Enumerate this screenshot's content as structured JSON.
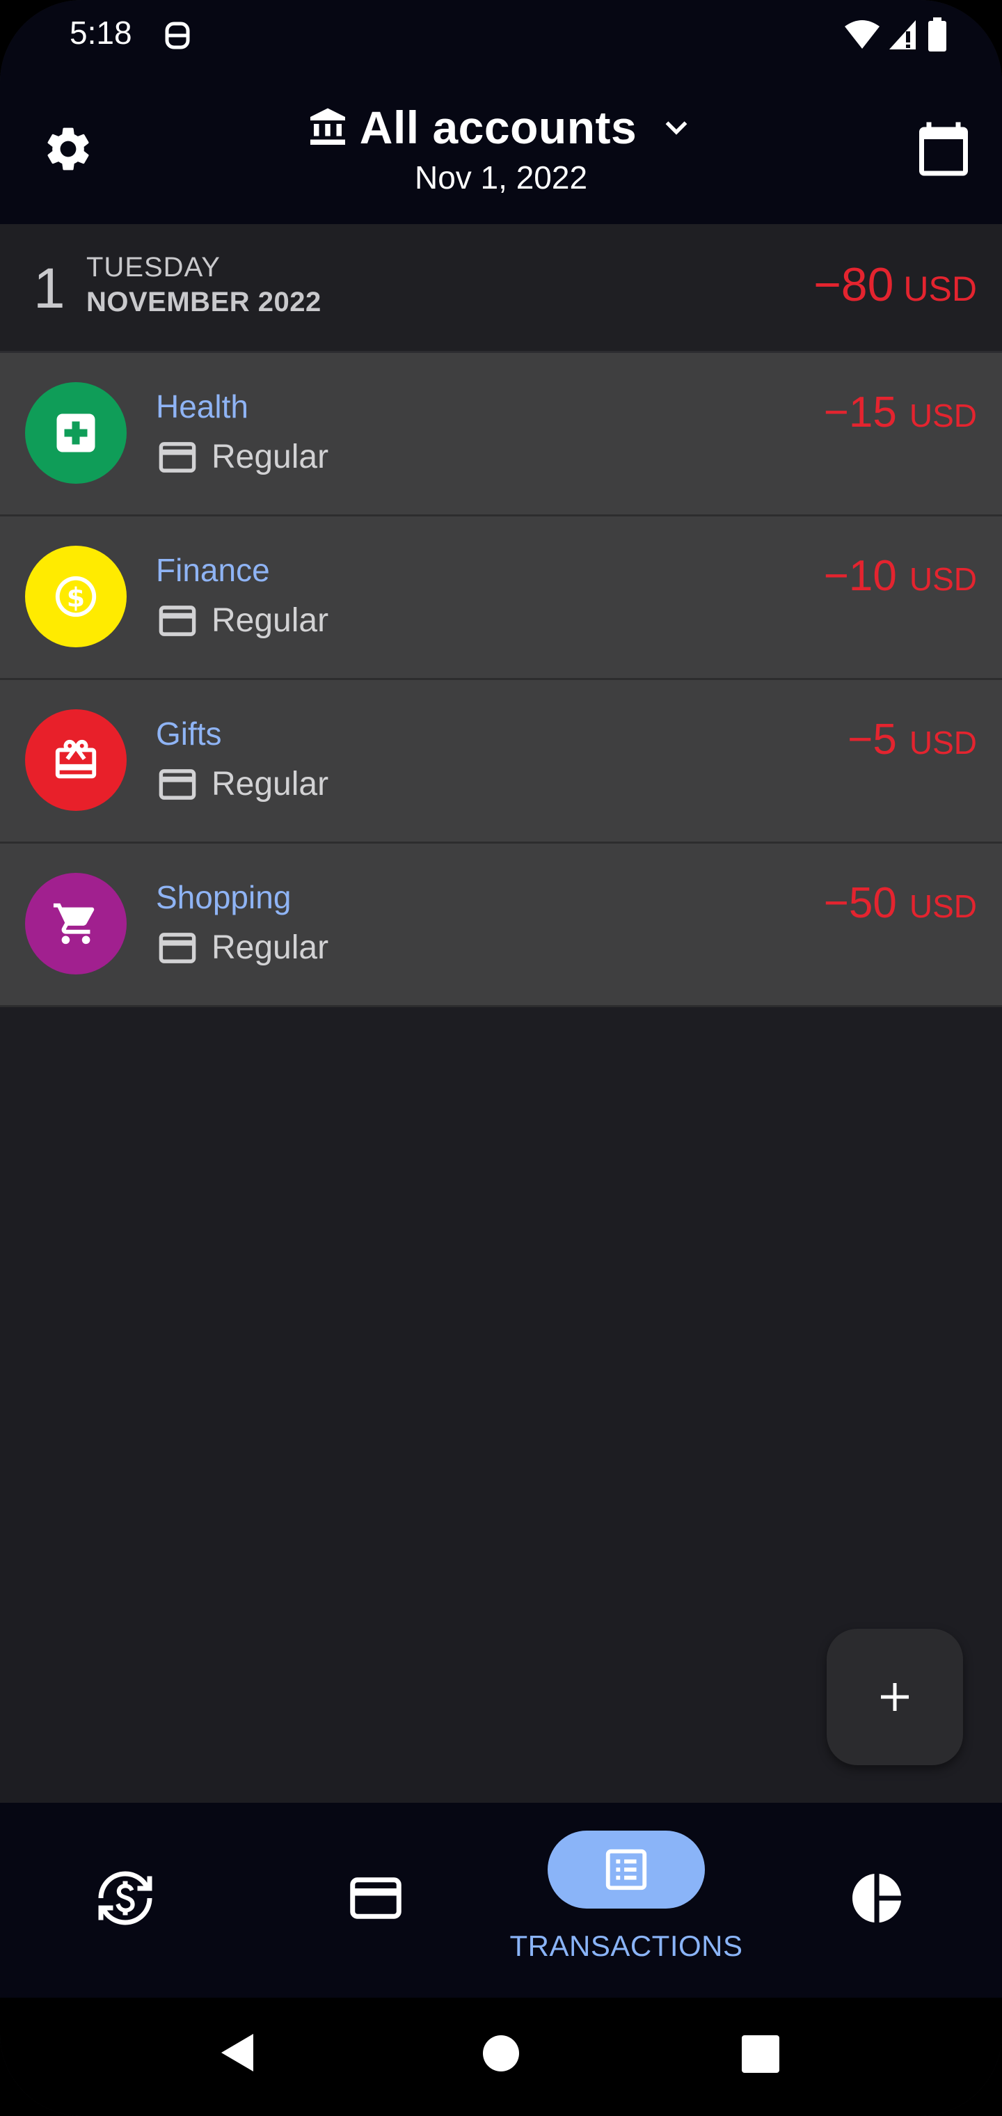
{
  "status_bar": {
    "time": "5:18"
  },
  "header": {
    "account_title": "All accounts",
    "date": "Nov 1, 2022"
  },
  "day_group": {
    "day_number": "1",
    "weekday": "TUESDAY",
    "month_year": "NOVEMBER 2022",
    "total_amount": "−80",
    "total_currency": "USD"
  },
  "transactions": [
    {
      "category": "Health",
      "account": "Regular",
      "amount": "−15",
      "currency": "USD",
      "icon": "medical-cross-icon",
      "color": "#0f9d58"
    },
    {
      "category": "Finance",
      "account": "Regular",
      "amount": "−10",
      "currency": "USD",
      "icon": "dollar-coin-icon",
      "color": "#ffeb00"
    },
    {
      "category": "Gifts",
      "account": "Regular",
      "amount": "−5",
      "currency": "USD",
      "icon": "gift-icon",
      "color": "#e8202a"
    },
    {
      "category": "Shopping",
      "account": "Regular",
      "amount": "−50",
      "currency": "USD",
      "icon": "shopping-cart-icon",
      "color": "#a1208f"
    }
  ],
  "bottom_nav": {
    "items": [
      {
        "icon": "currency-exchange-icon",
        "label": ""
      },
      {
        "icon": "credit-card-icon",
        "label": ""
      },
      {
        "icon": "transactions-list-icon",
        "label": "TRANSACTIONS",
        "active": true
      },
      {
        "icon": "pie-chart-icon",
        "label": ""
      }
    ]
  },
  "colors": {
    "accent": "#8ab4f8",
    "expense": "#e4242f",
    "background": "#1d1d22",
    "bar_background": "#060713"
  }
}
